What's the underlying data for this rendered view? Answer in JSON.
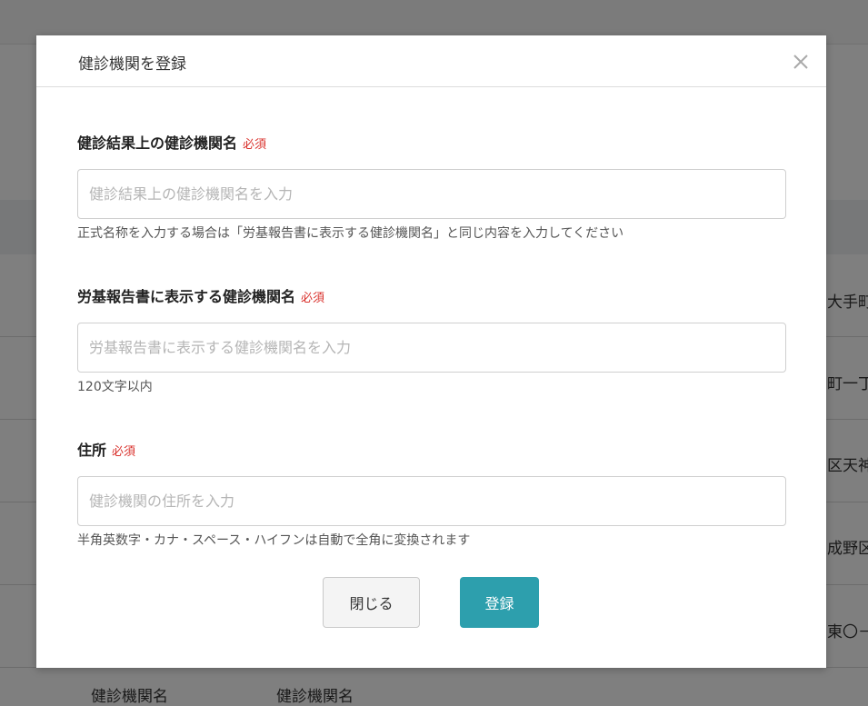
{
  "background": {
    "rows": [
      "大手町",
      "町一丁目",
      "区天神",
      "成野区",
      "東〇－"
    ],
    "bottom_text": "健診機関名　　　　　　　健診機関名"
  },
  "modal": {
    "title": "健診機関を登録",
    "close_icon": "close-icon",
    "required_label": "必須",
    "fields": [
      {
        "label": "健診結果上の健診機関名",
        "placeholder": "健診結果上の健診機関名を入力",
        "hint": "正式名称を入力する場合は「労基報告書に表示する健診機関名」と同じ内容を入力してください"
      },
      {
        "label": "労基報告書に表示する健診機関名",
        "placeholder": "労基報告書に表示する健診機関名を入力",
        "hint": "120文字以内"
      },
      {
        "label": "住所",
        "placeholder": "健診機関の住所を入力",
        "hint": "半角英数字・カナ・スペース・ハイフンは自動で全角に変換されます"
      }
    ],
    "buttons": {
      "close_label": "閉じる",
      "submit_label": "登録"
    }
  },
  "colors": {
    "primary": "#2d9fad",
    "required": "#d9302b",
    "overlay": "rgba(0,0,0,0.5)"
  }
}
